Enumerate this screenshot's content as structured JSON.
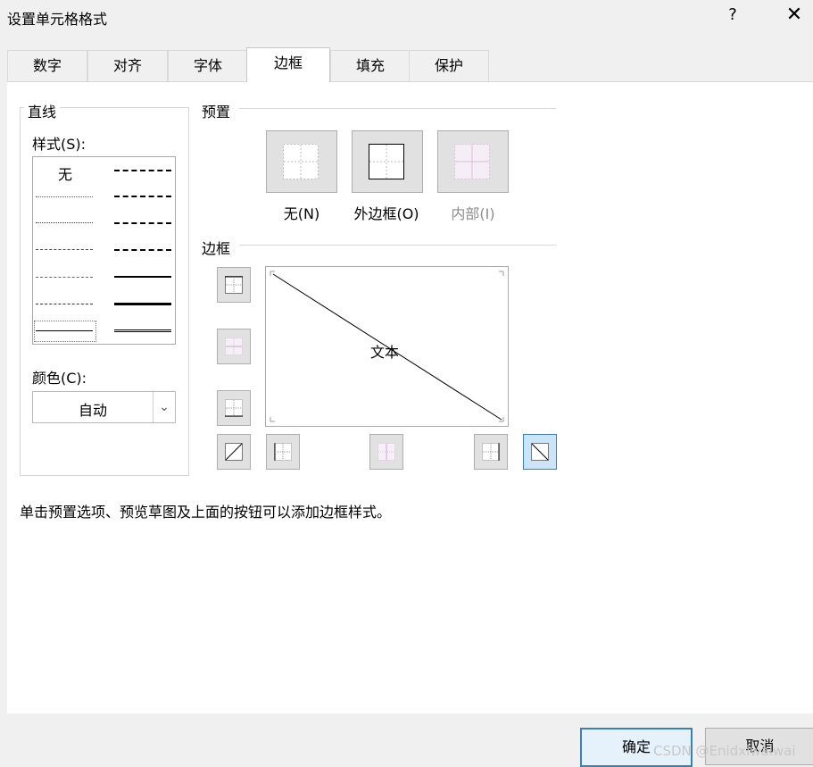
{
  "dialog": {
    "title": "设置单元格格式",
    "help": "?",
    "close": "✕"
  },
  "tabs": [
    {
      "label": "数字"
    },
    {
      "label": "对齐"
    },
    {
      "label": "字体"
    },
    {
      "label": "边框",
      "active": true
    },
    {
      "label": "填充"
    },
    {
      "label": "保护"
    }
  ],
  "line": {
    "group_title": "直线",
    "style_label": "样式(S):",
    "style_none": "无",
    "color_label": "颜色(C):",
    "color_value": "自动"
  },
  "presets": {
    "group_title": "预置",
    "none": "无(N)",
    "outline": "外边框(O)",
    "inside": "内部(I)"
  },
  "border": {
    "group_title": "边框",
    "preview_text": "文本"
  },
  "hint": "单击预置选项、预览草图及上面的按钮可以添加边框样式。",
  "footer": {
    "ok": "确定",
    "cancel": "取消",
    "watermark": "CSDN @Enidxiwaiwai"
  },
  "colors": {
    "accent": "#3c7fb1",
    "disabled_text": "#8d8d8d"
  }
}
